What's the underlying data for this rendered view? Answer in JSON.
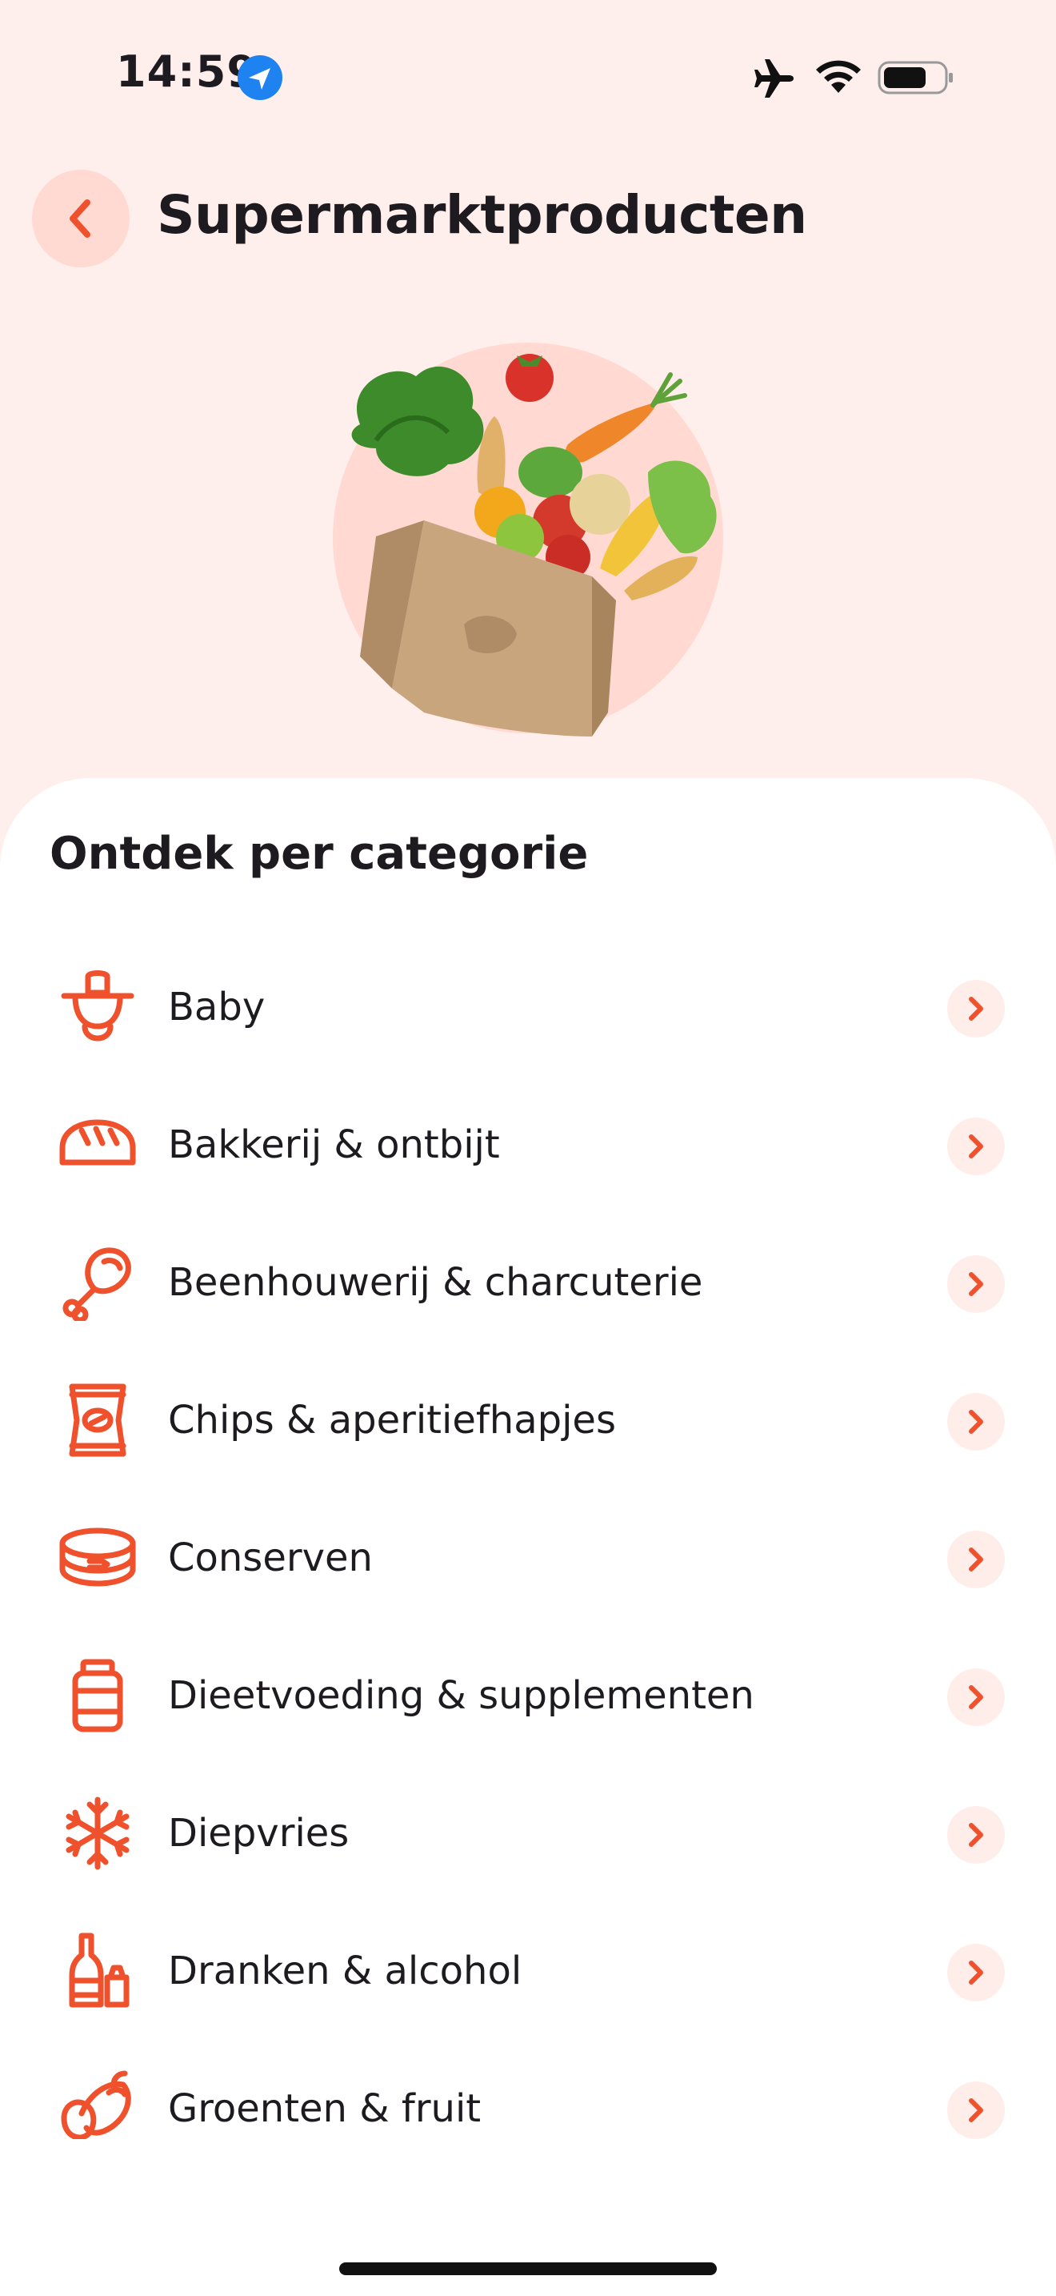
{
  "status": {
    "time": "14:59"
  },
  "header": {
    "title": "Supermarktproducten"
  },
  "section": {
    "title": "Ontdek per categorie"
  },
  "categories": [
    {
      "label": "Baby",
      "icon": "pacifier-icon"
    },
    {
      "label": "Bakkerij & ontbijt",
      "icon": "bread-icon"
    },
    {
      "label": "Beenhouwerij & charcuterie",
      "icon": "drumstick-icon"
    },
    {
      "label": "Chips & aperitiefhapjes",
      "icon": "chips-bag-icon"
    },
    {
      "label": "Conserven",
      "icon": "tin-can-icon"
    },
    {
      "label": "Dieetvoeding & supplementen",
      "icon": "supplement-jar-icon"
    },
    {
      "label": "Diepvries",
      "icon": "snowflake-icon"
    },
    {
      "label": "Dranken & alcohol",
      "icon": "bottle-icon"
    },
    {
      "label": "Groenten & fruit",
      "icon": "vegetables-icon"
    }
  ],
  "colors": {
    "accent": "#F0512D",
    "background": "#FFEFEC",
    "chevron_bg": "#FFEDE9"
  }
}
